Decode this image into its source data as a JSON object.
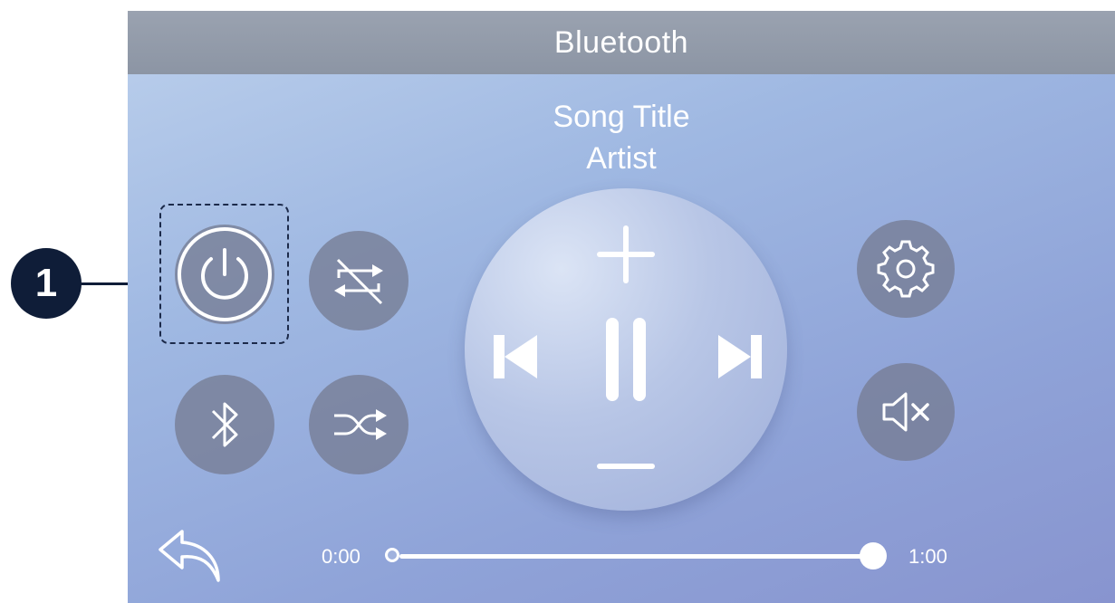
{
  "header": {
    "title": "Bluetooth"
  },
  "now_playing": {
    "song_title": "Song Title",
    "artist": "Artist"
  },
  "progress": {
    "current_time": "0:00",
    "total_time": "1:00",
    "position_fraction": 1.0
  },
  "callout": {
    "number": "1"
  },
  "icons": {
    "power": "power-icon",
    "repeat": "repeat-off-icon",
    "bluetooth": "bluetooth-icon",
    "shuffle": "shuffle-icon",
    "settings": "gear-icon",
    "mute": "mute-icon",
    "back": "back-arrow-icon",
    "volume_up": "plus-icon",
    "volume_down": "minus-icon",
    "previous": "skip-previous-icon",
    "pause": "pause-icon",
    "next": "skip-next-icon"
  },
  "colors": {
    "title_bar": "#8c95a4",
    "screen_gradient_start": "#bcd0ec",
    "screen_gradient_end": "#8894cf",
    "button_fill": "#767c94",
    "callout": "#0f1d38",
    "foreground": "#ffffff"
  }
}
